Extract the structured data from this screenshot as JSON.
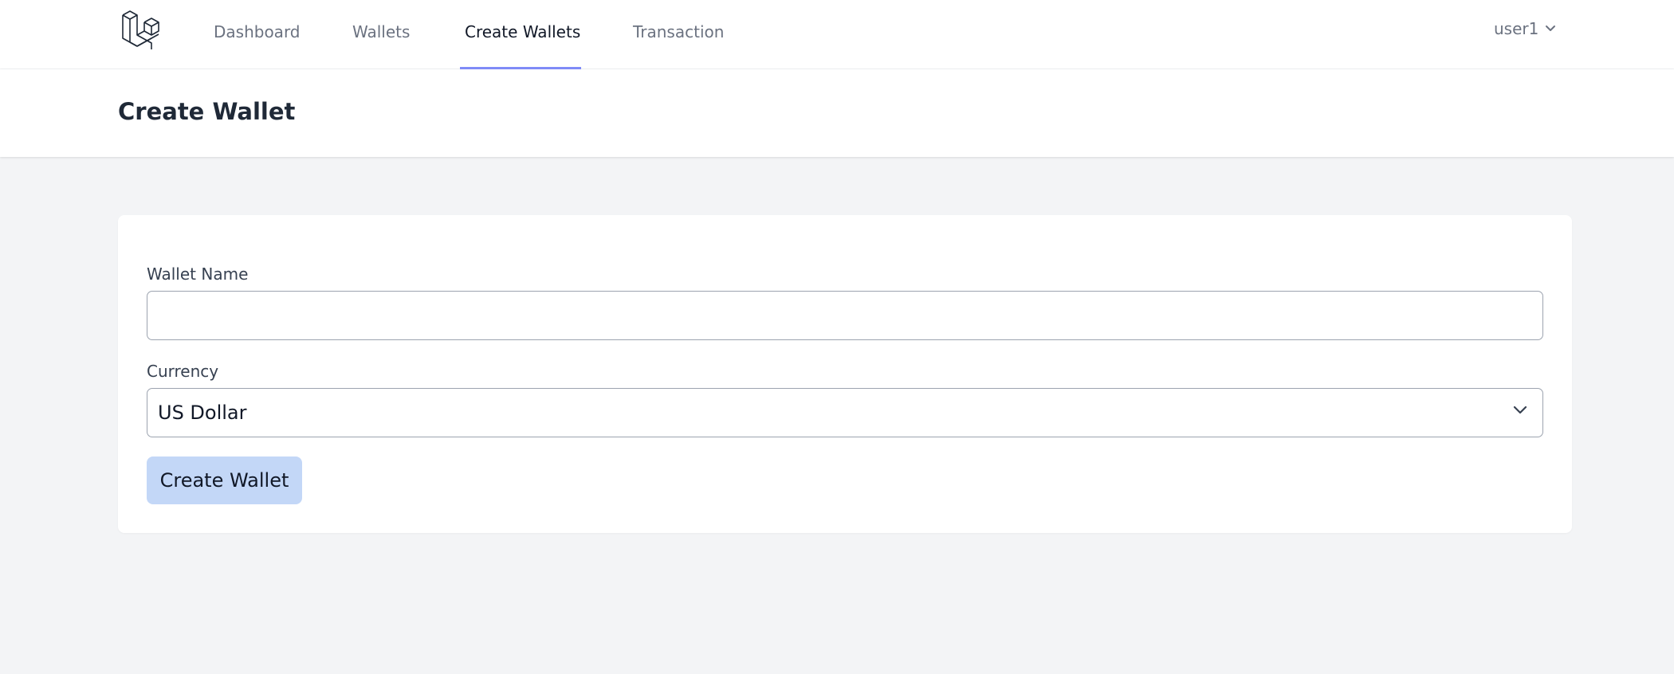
{
  "nav": {
    "logo_icon": "laravel-logo-icon",
    "items": [
      {
        "label": "Dashboard",
        "active": false
      },
      {
        "label": "Wallets",
        "active": false
      },
      {
        "label": "Create Wallets",
        "active": true
      },
      {
        "label": "Transaction",
        "active": false
      }
    ],
    "user": {
      "label": "user1",
      "icon": "chevron-down-icon"
    }
  },
  "header": {
    "title": "Create Wallet"
  },
  "form": {
    "wallet_name_label": "Wallet Name",
    "wallet_name_value": "",
    "currency_label": "Currency",
    "currency_selected": "US Dollar",
    "submit_label": "Create Wallet"
  },
  "colors": {
    "accent": "#818cf8",
    "button_bg": "#c3d7f7",
    "page_bg": "#f3f4f6"
  }
}
